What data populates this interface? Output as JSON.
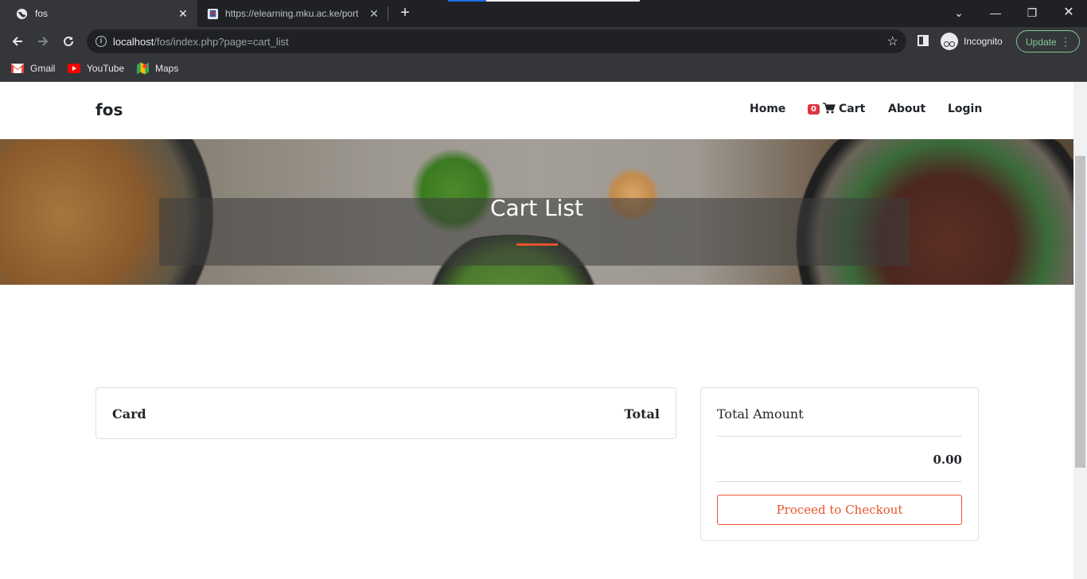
{
  "browser": {
    "tabs": [
      {
        "title": "fos",
        "active": true
      },
      {
        "title": "https://elearning.mku.ac.ke/port",
        "active": false
      }
    ],
    "url": {
      "host": "localhost",
      "path": "/fos/index.php?page=cart_list"
    },
    "profile_label": "Incognito",
    "update_label": "Update",
    "bookmarks": [
      {
        "label": "Gmail",
        "icon": "gmail-icon"
      },
      {
        "label": "YouTube",
        "icon": "youtube-icon"
      },
      {
        "label": "Maps",
        "icon": "maps-icon"
      }
    ],
    "colors": {
      "update_green": "#81c995",
      "load_blue": "#1a73e8"
    }
  },
  "site": {
    "brand": "fos",
    "nav": {
      "home": "Home",
      "cart_count": "0",
      "cart": "Cart",
      "about": "About",
      "login": "Login"
    },
    "hero_title": "Cart List",
    "cart_table": {
      "col_left": "Card",
      "col_right": "Total"
    },
    "summary": {
      "title": "Total Amount",
      "amount": "0.00",
      "checkout_label": "Proceed to Checkout"
    },
    "colors": {
      "accent": "#e8542d",
      "badge": "#dc3545"
    }
  }
}
